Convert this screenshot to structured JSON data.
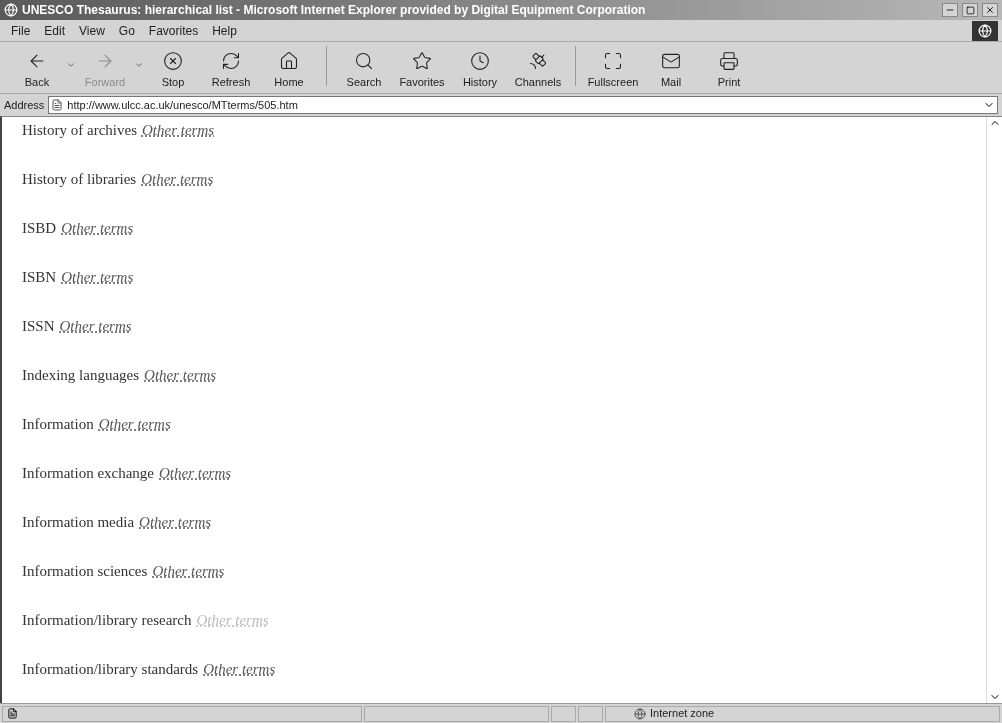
{
  "window": {
    "title": "UNESCO Thesaurus: hierarchical list - Microsoft Internet Explorer provided by Digital Equipment Corporation"
  },
  "menu": [
    "File",
    "Edit",
    "View",
    "Go",
    "Favorites",
    "Help"
  ],
  "toolbar": [
    {
      "label": "Back",
      "kind": "back",
      "disabled": false
    },
    {
      "kind": "dropdown"
    },
    {
      "label": "Forward",
      "kind": "forward",
      "disabled": true
    },
    {
      "kind": "dropdown"
    },
    {
      "label": "Stop",
      "kind": "stop",
      "disabled": false
    },
    {
      "label": "Refresh",
      "kind": "refresh",
      "disabled": false
    },
    {
      "label": "Home",
      "kind": "home",
      "disabled": false
    },
    {
      "kind": "separator"
    },
    {
      "label": "Search",
      "kind": "search",
      "disabled": false
    },
    {
      "label": "Favorites",
      "kind": "favorites",
      "disabled": false
    },
    {
      "label": "History",
      "kind": "history",
      "disabled": false
    },
    {
      "label": "Channels",
      "kind": "channels",
      "disabled": false
    },
    {
      "kind": "separator"
    },
    {
      "label": "Fullscreen",
      "kind": "fullscreen",
      "disabled": false
    },
    {
      "label": "Mail",
      "kind": "mail",
      "disabled": false
    },
    {
      "label": "Print",
      "kind": "print",
      "disabled": false
    }
  ],
  "address": {
    "label": "Address",
    "value": "http://www.ulcc.ac.uk/unesco/MTterms/505.htm"
  },
  "terms": [
    {
      "term": "History of archives",
      "link": "Other terms",
      "visited": false
    },
    {
      "term": "History of libraries",
      "link": "Other terms",
      "visited": false
    },
    {
      "term": "ISBD",
      "link": "Other terms",
      "visited": false
    },
    {
      "term": "ISBN",
      "link": "Other terms",
      "visited": false
    },
    {
      "term": "ISSN",
      "link": "Other terms",
      "visited": false
    },
    {
      "term": "Indexing languages",
      "link": "Other terms",
      "visited": false
    },
    {
      "term": "Information",
      "link": "Other terms",
      "visited": false
    },
    {
      "term": "Information exchange",
      "link": "Other terms",
      "visited": false
    },
    {
      "term": "Information media",
      "link": "Other terms",
      "visited": false
    },
    {
      "term": "Information sciences",
      "link": "Other terms",
      "visited": false
    },
    {
      "term": "Information/library research",
      "link": "Other terms",
      "visited": true
    },
    {
      "term": "Information/library standards",
      "link": "Other terms",
      "visited": false
    }
  ],
  "status_bar": {
    "zone": "Internet zone"
  }
}
